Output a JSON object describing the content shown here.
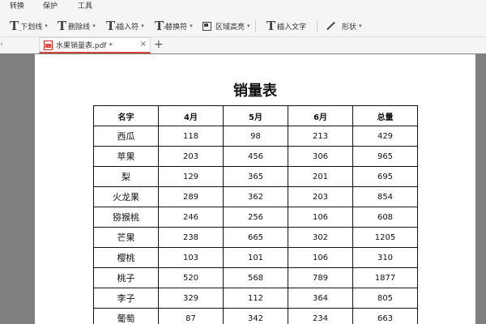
{
  "menubar": {
    "items": [
      "转换",
      "保护",
      "工具"
    ]
  },
  "toolbar": {
    "underline": "下划线",
    "strikethrough": "删除线",
    "insert_symbol": "插入符",
    "replace_symbol": "替换符",
    "area_highlight": "区域高亮",
    "insert_text": "插入文字",
    "shape": "形状"
  },
  "tab": {
    "title": "水果销量表.pdf *",
    "close": "×",
    "new_tab": "+"
  },
  "document": {
    "title": "销量表",
    "headers": [
      "名字",
      "4月",
      "5月",
      "6月",
      "总量"
    ],
    "rows": [
      [
        "西瓜",
        "118",
        "98",
        "213",
        "429"
      ],
      [
        "苹果",
        "203",
        "456",
        "306",
        "965"
      ],
      [
        "梨",
        "129",
        "365",
        "201",
        "695"
      ],
      [
        "火龙果",
        "289",
        "362",
        "203",
        "854"
      ],
      [
        "猕猴桃",
        "246",
        "256",
        "106",
        "608"
      ],
      [
        "芒果",
        "238",
        "665",
        "302",
        "1205"
      ],
      [
        "樱桃",
        "103",
        "101",
        "106",
        "310"
      ],
      [
        "桃子",
        "520",
        "568",
        "789",
        "1877"
      ],
      [
        "李子",
        "329",
        "112",
        "364",
        "805"
      ],
      [
        "葡萄",
        "87",
        "342",
        "234",
        "663"
      ]
    ]
  }
}
